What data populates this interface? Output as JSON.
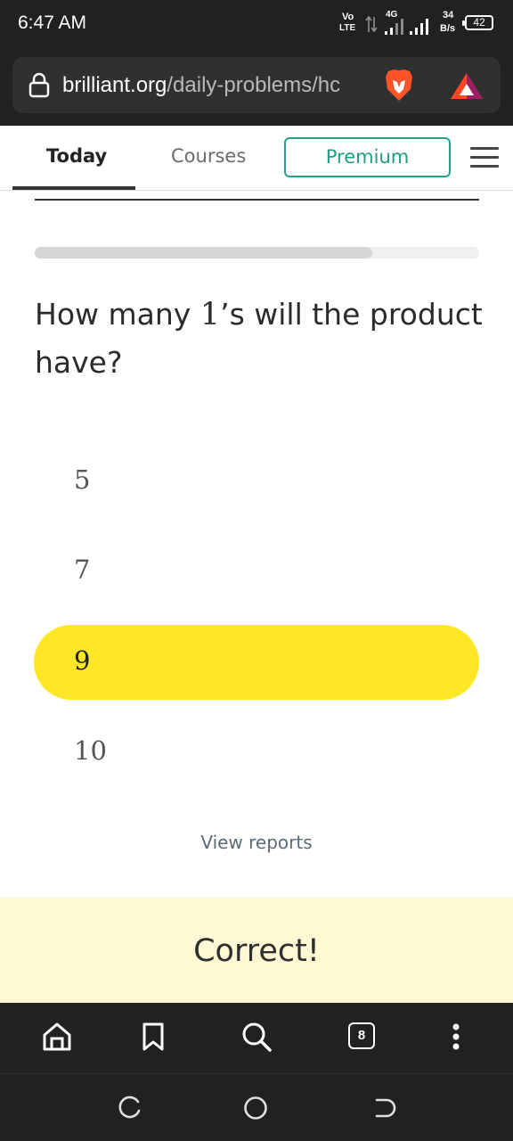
{
  "status_bar": {
    "time": "6:47 AM",
    "volte_top": "Vo",
    "volte_bottom": "LTE",
    "network_type": "4G",
    "speed_value": "34",
    "speed_unit": "B/s",
    "battery_level": "42",
    "icons": [
      "volte-icon",
      "data-arrows-icon",
      "signal-icon",
      "signal-icon-2",
      "battery-icon"
    ]
  },
  "browser": {
    "url_domain": "brilliant.org",
    "url_path": "/daily-problems/hc",
    "icons": [
      "lock-icon",
      "brave-lion-icon",
      "brave-rewards-triangle-icon"
    ]
  },
  "nav": {
    "tabs": [
      {
        "label": "Today",
        "active": true
      },
      {
        "label": "Courses",
        "active": false
      }
    ],
    "premium_label": "Premium",
    "menu_icon": "hamburger-menu-icon",
    "premium_color": "#2a9d8f"
  },
  "problem": {
    "progress": 0.76,
    "question_prefix": "How many ",
    "question_math": "1",
    "question_apostrophe_s": "’s",
    "question_suffix": " will the product have?",
    "options": [
      "5",
      "7",
      "9",
      "10"
    ],
    "selected_option": "9",
    "selected_color": "#ffe629"
  },
  "view_reports_label": "View reports",
  "feedback": {
    "text": "Correct!",
    "background": "#fff8d4"
  },
  "toolbar": {
    "icons": [
      "home-icon",
      "bookmark-icon",
      "search-icon",
      "tabs-icon",
      "more-icon"
    ],
    "tab_count": "8"
  },
  "system_nav": {
    "icons": [
      "recents-icon",
      "home-circle-icon",
      "back-icon"
    ]
  }
}
